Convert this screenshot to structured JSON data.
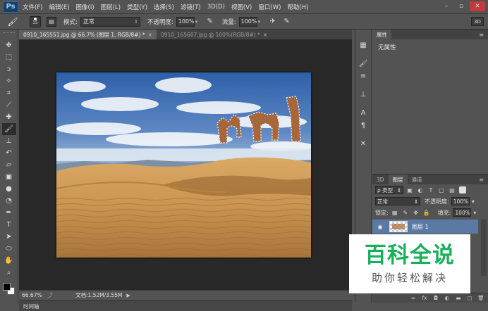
{
  "app": {
    "logo": "Ps"
  },
  "menu": [
    "文件(F)",
    "编辑(E)",
    "图像(I)",
    "图层(L)",
    "类型(Y)",
    "选择(S)",
    "滤镜(T)",
    "3D(D)",
    "视图(V)",
    "窗口(W)",
    "帮助(H)"
  ],
  "window_controls": {
    "minimize": "–",
    "maximize": "▫",
    "close": "✕"
  },
  "options": {
    "brush_size": "15",
    "mode_label": "模式:",
    "mode_value": "正常",
    "opacity_label": "不透明度:",
    "opacity_value": "100%",
    "flow_label": "流量:",
    "flow_value": "100%",
    "view_3d": "3D"
  },
  "tabs": [
    {
      "label": "0910_165551.jpg @ 66.7% (图层 1, RGB/8#) *",
      "close": "×",
      "active": true
    },
    {
      "label": "0910_165607.jpg @ 100%(RGB/8#) *",
      "close": "×",
      "active": false
    }
  ],
  "status": {
    "zoom": "66.67%",
    "doc": "文档:1.52M/3.55M",
    "arrow": "▶"
  },
  "timeline": {
    "label": "时间轴"
  },
  "properties": {
    "tab": "属性",
    "body": "无属性"
  },
  "layers": {
    "tabs": [
      "3D",
      "图层",
      "通道"
    ],
    "filter_value": "ρ 类型",
    "blend_mode": "正常",
    "opacity_label": "不透明度:",
    "opacity_value": "100%",
    "lock_label": "锁定:",
    "fill_label": "填充:",
    "fill_value": "100%",
    "items": [
      {
        "name": "图层 1"
      }
    ]
  },
  "watermark": {
    "big": "百科全说",
    "small": "助你轻松解决"
  }
}
